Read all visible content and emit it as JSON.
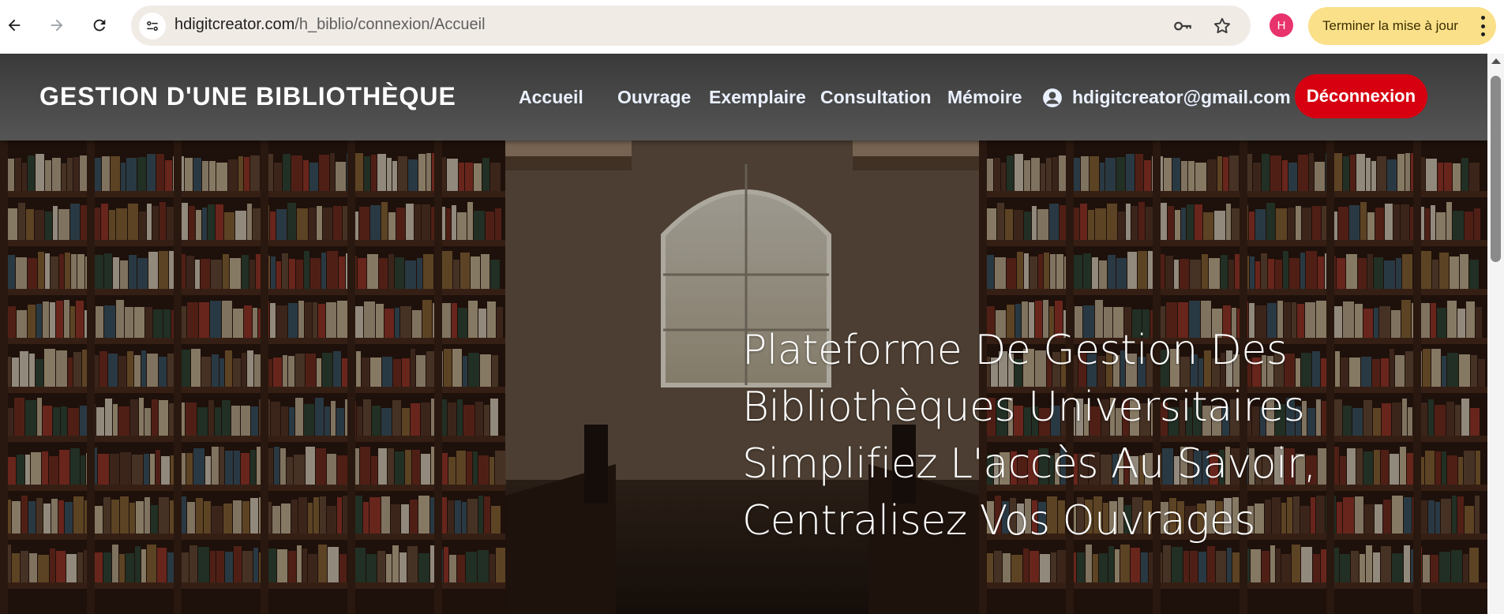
{
  "browser": {
    "url_host": "hdigitcreator.com",
    "url_path": "/h_biblio/connexion/Accueil",
    "profile_initial": "H",
    "update_label": "Terminer la mise à jour"
  },
  "navbar": {
    "brand": "GESTION D'UNE BIBLIOTHÈQUE",
    "items": [
      {
        "label": "Accueil"
      },
      {
        "label": "Ouvrage"
      },
      {
        "label": "Exemplaire"
      },
      {
        "label": "Consultation"
      },
      {
        "label": "Mémoire"
      }
    ],
    "user_email": "hdigitcreator@gmail.com",
    "logout_label": "Déconnexion"
  },
  "hero": {
    "lines": [
      "Plateforme De Gestion Des",
      "Bibliothèques Universitaires",
      "Simplifiez L'accès Au Savoir,",
      "Centralisez Vos Ouvrages"
    ]
  },
  "colors": {
    "navbar_bg": "#4a4a4a",
    "logout_bg": "#d60010",
    "update_bg": "#fbe08a",
    "avatar_bg": "#e8336d"
  }
}
